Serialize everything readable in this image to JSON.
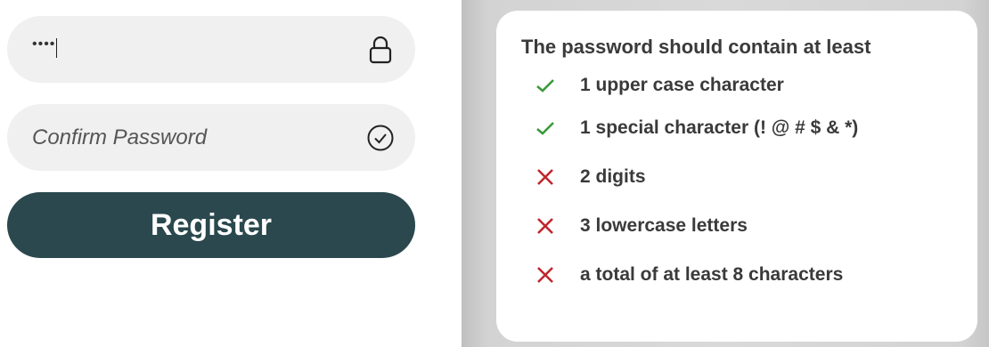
{
  "form": {
    "password": {
      "value": "••••",
      "icon": "lock-icon"
    },
    "confirm_password": {
      "placeholder": "Confirm Password",
      "icon": "check-circle-icon"
    },
    "register_label": "Register"
  },
  "requirements": {
    "title": "The password should contain at least",
    "items": [
      {
        "label": "1 upper case character",
        "met": true
      },
      {
        "label": "1 special character (! @ # $ & *)",
        "met": true
      },
      {
        "label": "2 digits",
        "met": false
      },
      {
        "label": "3 lowercase letters",
        "met": false
      },
      {
        "label": "a total of at least 8 characters",
        "met": false
      }
    ]
  },
  "colors": {
    "button": "#2a484d",
    "field_bg": "#f0f0f0",
    "met": "#3a9a3a",
    "unmet": "#c0272d"
  }
}
